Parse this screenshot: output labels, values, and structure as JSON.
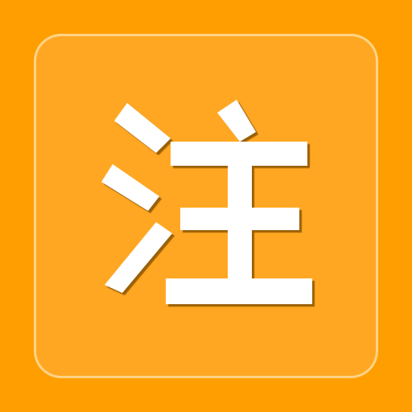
{
  "icon": {
    "glyph": "注",
    "glyph_icon": "zhu-character-icon",
    "colors": {
      "background": "#FF9E00",
      "tile": "#FFA722",
      "tile_border": "#FFE2AA",
      "glyph": "#FFFFFF",
      "glyph_shadow": "#8A5200"
    }
  }
}
